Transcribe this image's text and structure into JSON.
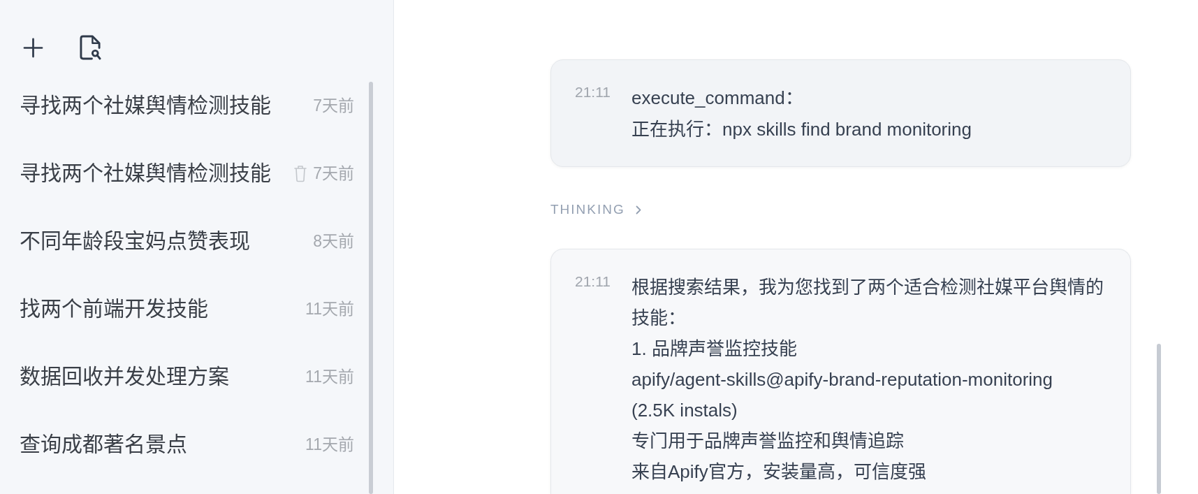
{
  "sidebar": {
    "conversations": [
      {
        "title": "寻找两个社媒舆情检测技能",
        "time": "7天前",
        "hovered": false
      },
      {
        "title": "寻找两个社媒舆情检测技能",
        "time": "7天前",
        "hovered": true
      },
      {
        "title": "不同年龄段宝妈点赞表现",
        "time": "8天前",
        "hovered": false
      },
      {
        "title": "找两个前端开发技能",
        "time": "11天前",
        "hovered": false
      },
      {
        "title": "数据回收并发处理方案",
        "time": "11天前",
        "hovered": false
      },
      {
        "title": "查询成都著名景点",
        "time": "11天前",
        "hovered": false
      }
    ]
  },
  "chat": {
    "messages": [
      {
        "kind": "tool",
        "time": "21:11",
        "lines": [
          "execute_command：",
          "正在执行：npx skills find brand monitoring"
        ]
      },
      {
        "kind": "thinking",
        "label": "THINKING",
        "expanded": false
      },
      {
        "kind": "reply",
        "time": "21:11",
        "lines": [
          "根据搜索结果，我为您找到了两个适合检测社媒平台舆情的技能：",
          "1. 品牌声誉监控技能",
          "apify/agent-skills@apify-brand-reputation-monitoring",
          "(2.5K instals)",
          "专门用于品牌声誉监控和舆情追踪",
          "来自Apify官方，安装量高，可信度强"
        ]
      }
    ]
  }
}
